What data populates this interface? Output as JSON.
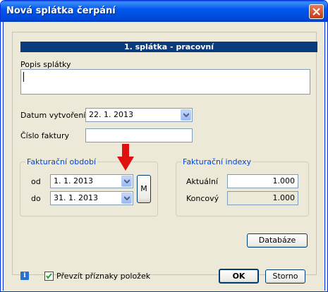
{
  "window": {
    "title": "Nová splátka čerpání"
  },
  "header": {
    "title": "1. splátka - pracovní"
  },
  "popis": {
    "label": "Popis splátky",
    "value": ""
  },
  "datum": {
    "label": "Datum vytvoření",
    "value": "22. 1. 2013"
  },
  "faktura": {
    "label": "Číslo faktury",
    "value": ""
  },
  "obdobi": {
    "legend": "Fakturační období",
    "od_label": "od",
    "od_value": "1. 1. 2013",
    "do_label": "do",
    "do_value": "31. 1. 2013",
    "m_button": "M"
  },
  "indexy": {
    "legend": "Fakturační indexy",
    "aktualni_label": "Aktuální",
    "aktualni_value": "1.000",
    "koncovy_label": "Koncový",
    "koncovy_value": "1.000"
  },
  "buttons": {
    "databaze": "Databáze",
    "ok": "OK",
    "storno": "Storno"
  },
  "footer": {
    "checkbox_label": "Převzít příznaky položek",
    "checkbox_checked": true
  },
  "colors": {
    "title_bar": "#0058ee",
    "header_band": "#0a3b7c",
    "legend_text": "#0046d5",
    "arrow": "#e01010"
  }
}
